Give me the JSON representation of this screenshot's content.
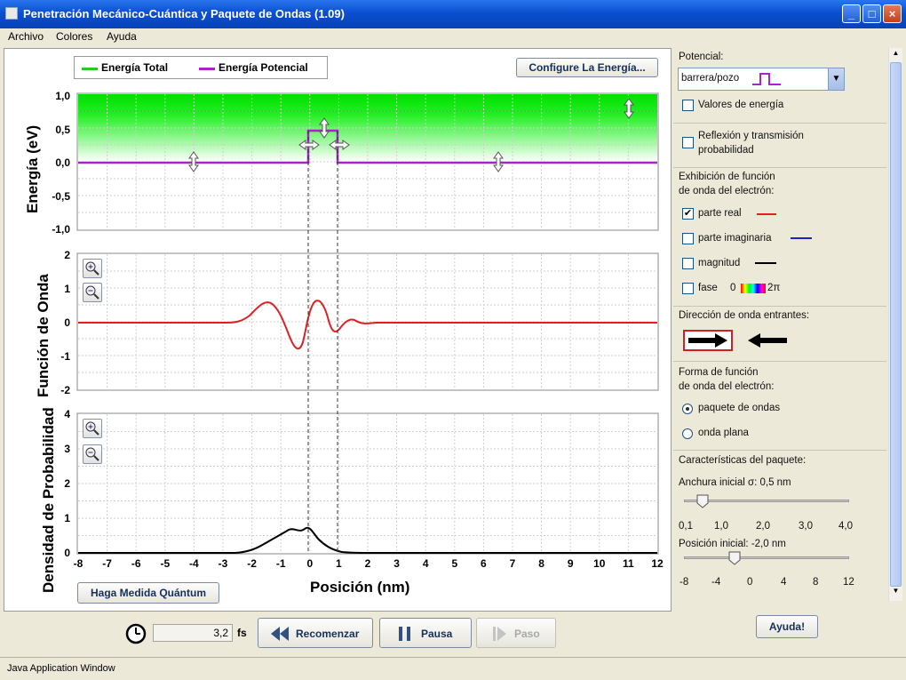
{
  "window": {
    "title": "Penetración Mecánico-Cuántica y Paquete de Ondas (1.09)",
    "min_icon": "minimize-icon",
    "max_icon": "maximize-icon",
    "close_icon": "close-icon"
  },
  "menu": {
    "items": [
      "Archivo",
      "Colores",
      "Ayuda"
    ]
  },
  "legend": {
    "total": "Energía Total",
    "potential": "Energía Potencial",
    "total_color": "#22cc22",
    "potential_color": "#aa22cc"
  },
  "configure_button": "Configure La Energía...",
  "energy_plot": {
    "ylabel": "Energía (eV)",
    "yticks": [
      "1,0",
      "0,5",
      "0,0",
      "-0,5",
      "-1,0"
    ]
  },
  "wave_plot": {
    "ylabel": "Función de Onda",
    "yticks": [
      "2",
      "1",
      "0",
      "-1",
      "-2"
    ]
  },
  "prob_plot": {
    "ylabel": "Densidad de Probabilidad",
    "yticks": [
      "4",
      "3",
      "2",
      "1",
      "0"
    ]
  },
  "xaxis": {
    "label": "Posición (nm)",
    "ticks": [
      "-8",
      "-7",
      "-6",
      "-5",
      "-4",
      "-3",
      "-2",
      "-1",
      "0",
      "1",
      "2",
      "3",
      "4",
      "5",
      "6",
      "7",
      "8",
      "9",
      "10",
      "11",
      "12"
    ]
  },
  "measure_button": "Haga Medida Quántum",
  "controls": {
    "time_value": "3,2",
    "time_unit": "fs",
    "restart": "Recomenzar",
    "pause": "Pausa",
    "step": "Paso",
    "help_button": "Ayuda!"
  },
  "right": {
    "potential_label": "Potencial:",
    "potential_selected": "barrera/pozo",
    "energy_values": "Valores de energía",
    "reflection_line1": "Reflexión y transmisión",
    "reflection_line2": "probabilidad",
    "display_line1": "Exhibición de función",
    "display_line2": "de onda del electrón:",
    "real": "parte real",
    "imag": "parte imaginaria",
    "mag": "magnitud",
    "phase": "fase",
    "phase_0": "0",
    "phase_2pi": "2π",
    "real_color": "#e02020",
    "imag_color": "#2020c8",
    "mag_color": "#000000",
    "direction": "Dirección de onda entrantes:",
    "form_line1": "Forma de función",
    "form_line2": "de onda del electrón:",
    "packet": "paquete de ondas",
    "plane": "onda plana",
    "packet_props": "Características del paquete:",
    "width_label": "Anchura inicial σ: 0,5 nm",
    "width_ticks": [
      "0,1",
      "1,0",
      "2,0",
      "3,0",
      "4,0"
    ],
    "position_label": "Posición inicial: -2,0 nm",
    "position_ticks": [
      "-8",
      "-4",
      "0",
      "4",
      "8",
      "12"
    ]
  },
  "status": "Java Application Window"
}
